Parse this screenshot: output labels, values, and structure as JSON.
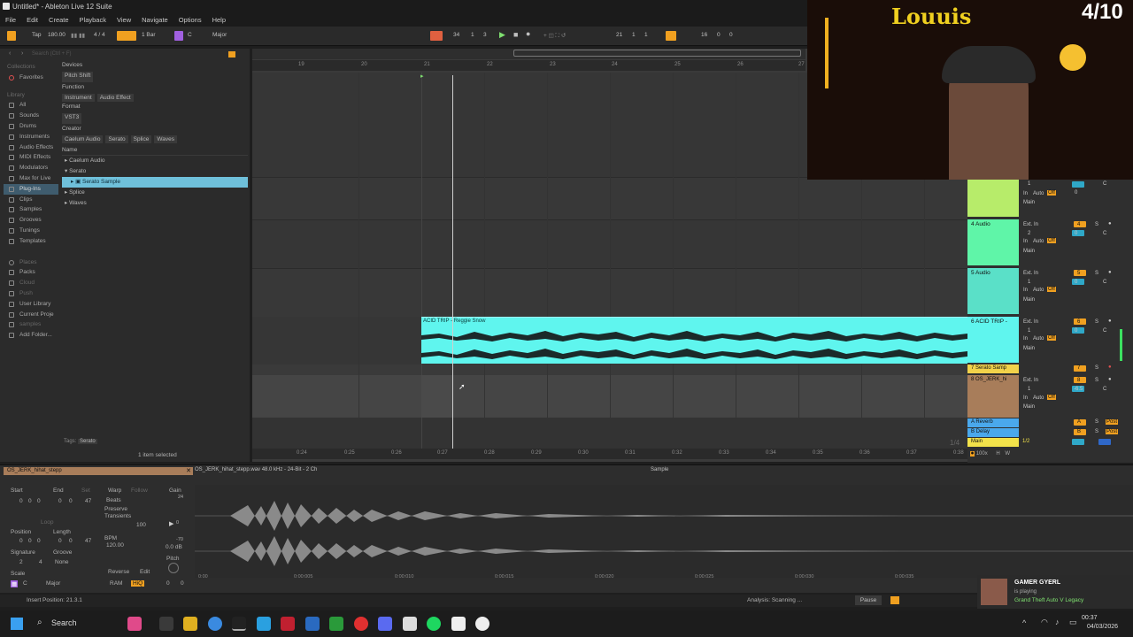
{
  "window": {
    "title": "Untitled* - Ableton Live 12 Suite"
  },
  "menu": [
    "File",
    "Edit",
    "Create",
    "Playback",
    "View",
    "Navigate",
    "Options",
    "Help"
  ],
  "toolbar": {
    "tap": "Tap",
    "tempo": "180.00",
    "signature": "4 / 4",
    "quantize": "1 Bar",
    "key": "C",
    "scale": "Major",
    "position": [
      "34",
      "1",
      "3"
    ],
    "loop_start": [
      "21",
      "1",
      "1"
    ],
    "loop_length": [
      "16",
      "0",
      "0"
    ]
  },
  "browser": {
    "search_placeholder": "Search (Ctrl + F)",
    "collections_header": "Collections",
    "favorites": "Favorites",
    "library_header": "Library",
    "categories": [
      "All",
      "Sounds",
      "Drums",
      "Instruments",
      "Audio Effects",
      "MIDI Effects",
      "Modulators",
      "Max for Live",
      "Plug-Ins",
      "Clips",
      "Samples",
      "Grooves",
      "Tunings",
      "Templates"
    ],
    "places_header": "Places",
    "places": [
      "Packs",
      "Cloud",
      "Push",
      "User Library",
      "Current Proje",
      "samples",
      "Add Folder..."
    ],
    "filters": {
      "devices_label": "Devices",
      "devices_value": "Pitch Shift",
      "function_label": "Function",
      "function_values": [
        "Instrument",
        "Audio Effect"
      ],
      "format_label": "Format",
      "format_value": "VST3",
      "creator_label": "Creator",
      "creator_values": [
        "Caelum Audio",
        "Serato",
        "Splice",
        "Waves"
      ]
    },
    "name_header": "Name",
    "tree": [
      "Caelum Audio",
      "Serato",
      "Serato Sample",
      "Splice",
      "Waves"
    ],
    "tags_label": "Tags:",
    "tag": "Serato",
    "selection_status": "1 item selected"
  },
  "arrangement": {
    "bar_ruler": [
      "19",
      "20",
      "21",
      "22",
      "23",
      "24",
      "25",
      "26",
      "27"
    ],
    "time_ruler": [
      "0:24",
      "0:25",
      "0:26",
      "0:27",
      "0:28",
      "0:29",
      "0:30",
      "0:31",
      "0:32",
      "0:33",
      "0:34",
      "0:35",
      "0:36",
      "0:37",
      "0:38"
    ],
    "clip_title": "ACID TRIP - Reggie Snow",
    "page_indicator": "1/4"
  },
  "tracks": [
    {
      "name": "",
      "color": "#b7ec6a",
      "input": "Ext. In",
      "ch": "1",
      "out": "Main",
      "num": "",
      "vol": "0",
      "pan": "C"
    },
    {
      "name": "4 Audio",
      "color": "#5ff5a8",
      "input": "Ext. In",
      "ch": "2",
      "out": "Main",
      "num": "4",
      "vol": "0",
      "pan": "C"
    },
    {
      "name": "5 Audio",
      "color": "#5ae0c8",
      "input": "Ext. In",
      "ch": "1",
      "out": "Main",
      "num": "5",
      "vol": "0",
      "pan": "C"
    },
    {
      "name": "6 ACID TRIP -",
      "color": "#5ff5ee",
      "input": "Ext. In",
      "ch": "1",
      "out": "Main",
      "num": "6",
      "vol": "0",
      "pan": "C"
    },
    {
      "name": "7 Serato Samp",
      "color": "#f2d24a",
      "input": "",
      "ch": "",
      "out": "",
      "num": "7",
      "vol": "",
      "pan": ""
    },
    {
      "name": "8 OS_JERK_hi",
      "color": "#a87d5a",
      "input": "Ext. In",
      "ch": "1",
      "out": "Main",
      "num": "8",
      "vol": "-6.5",
      "pan": "C"
    }
  ],
  "returns": [
    {
      "name": "A Reverb",
      "color": "#4aa8ec",
      "label": "A",
      "post": "Post"
    },
    {
      "name": "B Delay",
      "color": "#4aa8ec",
      "label": "B",
      "post": "Post"
    },
    {
      "name": "Main",
      "color": "#f2e24a",
      "label": "1/2",
      "post": "Post"
    }
  ],
  "mixer_footer": {
    "cpu": "100x",
    "h": "H",
    "w": "W"
  },
  "detail": {
    "clip_name": "OS_JERK_hihat_stepp",
    "file_info": "OS_JERK_hihat_stepp.wav 48.0 kHz - 24-Bit - 2 Ch",
    "sample_label": "Sample",
    "start_label": "Start",
    "end_label": "End",
    "set_label": "Set",
    "start": [
      "0",
      "0",
      "0"
    ],
    "end": [
      "0",
      "0",
      "47"
    ],
    "loop_label": "Loop",
    "position_label": "Position",
    "length_label": "Length",
    "position": [
      "0",
      "0",
      "0"
    ],
    "length": [
      "0",
      "0",
      "47"
    ],
    "signature_label": "Signature",
    "groove_label": "Groove",
    "signature": [
      "2",
      "4"
    ],
    "groove": "None",
    "scale_label": "Scale",
    "scale_key": "C",
    "scale_mode": "Major",
    "warp": "Warp",
    "follow": "Follow",
    "warp_mode": "Beats",
    "preserve_label": "Preserve",
    "preserve": "Transients",
    "bpm_label": "BPM",
    "bpm": "120.00",
    "beats_val": "100",
    "reverse": "Reverse",
    "edit": "Edit",
    "ram": "RAM",
    "hiq": "HiQ",
    "gain_label": "Gain",
    "gain_db": "0.0 dB",
    "pitch_label": "Pitch",
    "gain_marks": [
      "24",
      "0",
      "-70"
    ],
    "pitch": [
      "0",
      "0"
    ],
    "time_marks": [
      "0:00",
      "0:00:005",
      "0:00:010",
      "0:00:015",
      "0:00:020",
      "0:00:025",
      "0:00:030",
      "0:00:035"
    ]
  },
  "status": {
    "left": "Insert Position: 21.3.1",
    "analysis": "Analysis: Scanning ...",
    "pause": "Pause"
  },
  "overlay": {
    "name": "Louuis",
    "counter": "4/10"
  },
  "notification": {
    "title": "GAMER GYERL",
    "subtitle": "is playing",
    "game": "Grand Theft Auto V Legacy"
  },
  "taskbar": {
    "search": "Search",
    "time": "00:37",
    "date": "04/03/2026"
  }
}
